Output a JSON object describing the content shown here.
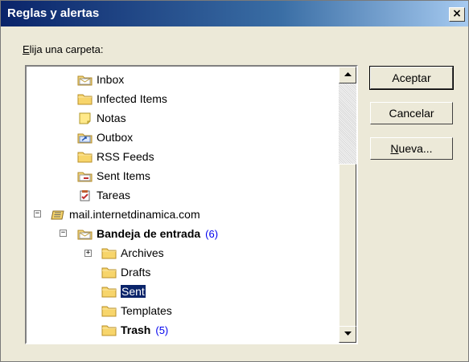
{
  "window": {
    "title": "Reglas y alertas",
    "close_glyph": "×"
  },
  "prompt": {
    "label_underlined": "E",
    "label_rest": "lija una carpeta:"
  },
  "tree": {
    "items": [
      {
        "label": "Inbox",
        "icon": "inbox-folder-icon"
      },
      {
        "label": "Infected Items",
        "icon": "folder-icon"
      },
      {
        "label": "Notas",
        "icon": "notes-icon"
      },
      {
        "label": "Outbox",
        "icon": "outbox-icon"
      },
      {
        "label": "RSS Feeds",
        "icon": "folder-icon"
      },
      {
        "label": "Sent Items",
        "icon": "sent-items-icon"
      },
      {
        "label": "Tareas",
        "icon": "tasks-icon"
      },
      {
        "label": "mail.internetdinamica.com",
        "icon": "mailbox-icon"
      },
      {
        "label": "Bandeja de entrada",
        "icon": "inbox-folder-icon",
        "count": "(6)"
      },
      {
        "label": "Archives",
        "icon": "folder-icon"
      },
      {
        "label": "Drafts",
        "icon": "folder-icon"
      },
      {
        "label": "Sent",
        "icon": "folder-icon"
      },
      {
        "label": "Templates",
        "icon": "folder-icon"
      },
      {
        "label": "Trash",
        "icon": "folder-icon",
        "count": "(5)"
      }
    ],
    "selected": "Sent"
  },
  "buttons": {
    "accept": "Aceptar",
    "cancel": "Cancelar",
    "new_underlined": "N",
    "new_rest": "ueva..."
  },
  "colors": {
    "selection": "#0a246a",
    "count": "#0000ee",
    "dialog_bg": "#ece9d8"
  }
}
